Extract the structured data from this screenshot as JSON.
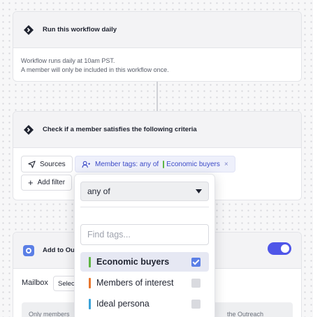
{
  "colors": {
    "accent": "#4f56e8",
    "tag_text": "#3b49c6"
  },
  "step1": {
    "title": "Run this workflow daily",
    "icon": "diamond-icon",
    "line1": "Workflow runs daily at 10am PST.",
    "line2": "A member will only be included in this workflow once."
  },
  "step2": {
    "title": "Check if a member satisfies the following criteria",
    "icon": "diamond-icon",
    "sources_label": "Sources",
    "tag_filter": {
      "prefix": "Member tags: any of",
      "value": "Economic buyers",
      "value_color": "#5fb543",
      "remove": "×"
    },
    "add_filter_label": "Add filter"
  },
  "step3": {
    "title": "Add to Ou",
    "icon": "outreach-icon",
    "mailbox_label": "Mailbox",
    "mailbox_select": "Selec",
    "toggle_on": true,
    "note_left": "Only members",
    "note_right": "the Outreach"
  },
  "dropdown": {
    "mode": "any of",
    "search_placeholder": "Find tags...",
    "tags": [
      {
        "label": "Economic buyers",
        "color": "#5fb543",
        "checked": true
      },
      {
        "label": "Members of interest",
        "color": "#e8772e",
        "checked": false
      },
      {
        "label": "Ideal persona",
        "color": "#3ba3d9",
        "checked": false
      }
    ]
  }
}
